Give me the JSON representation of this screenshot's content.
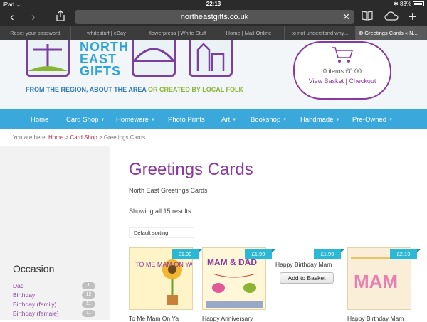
{
  "status": {
    "device": "iPad",
    "time": "22:13",
    "battery": "83%"
  },
  "browser": {
    "url": "northeastgifts.co.uk",
    "tabs": [
      {
        "label": "Reset your password",
        "active": false
      },
      {
        "label": "whitestuff | eBay",
        "active": false
      },
      {
        "label": "flowerpress | White Stuff",
        "active": false
      },
      {
        "label": "Home | Mail Online",
        "active": false
      },
      {
        "label": "to not understand why...",
        "active": false
      },
      {
        "label": "Greetings Cards « N...",
        "active": true
      }
    ]
  },
  "header": {
    "logo_text": [
      "NORTH",
      "EAST",
      "GIFTS"
    ],
    "tagline_part1": "FROM THE REGION, ABOUT THE AREA",
    "tagline_part2": "OR CREATED BY LOCAL FOLK",
    "cart": {
      "items": "0 items £0.00",
      "view_basket": "View Basket",
      "separator": "|",
      "checkout": "Checkout"
    }
  },
  "nav": [
    {
      "label": "Home",
      "caret": false
    },
    {
      "label": "Card Shop",
      "caret": true
    },
    {
      "label": "Homeware",
      "caret": true
    },
    {
      "label": "Photo Prints",
      "caret": false
    },
    {
      "label": "Art",
      "caret": true
    },
    {
      "label": "Bookshop",
      "caret": true
    },
    {
      "label": "Handmade",
      "caret": true
    },
    {
      "label": "Pre-Owned",
      "caret": true
    }
  ],
  "breadcrumb": {
    "prefix": "You are here:",
    "home": "Home",
    "sep": ">",
    "card_shop": "Card Shop",
    "current": "Greetings Cards"
  },
  "sidebar": {
    "title": "Occasion",
    "items": [
      {
        "label": "Dad",
        "count": "1"
      },
      {
        "label": "Birthday",
        "count": "12"
      },
      {
        "label": "Birthday (family)",
        "count": "11"
      },
      {
        "label": "Birthday (female)",
        "count": "11"
      }
    ]
  },
  "main": {
    "title": "Greetings Cards",
    "description": "North East Greetings Cards",
    "result_count": "Showing all 15 results",
    "sorting": "Default sorting",
    "products": [
      {
        "title": "To Me Mam On Ya",
        "price": "£1.99",
        "card_text": "TO ME MAM ON YA BIRTHDAY",
        "has_image": true
      },
      {
        "title": "Happy Anniversary",
        "price": "£1.99",
        "card_text": "MAM & DAD",
        "has_image": true
      },
      {
        "title": "Happy Birthday Mam",
        "price": "£1.99",
        "button": "Add to Basket",
        "has_image": false
      },
      {
        "title": "Happy Birthday Mam",
        "price": "£2.19",
        "card_text": "MAM",
        "has_image": true
      }
    ]
  }
}
